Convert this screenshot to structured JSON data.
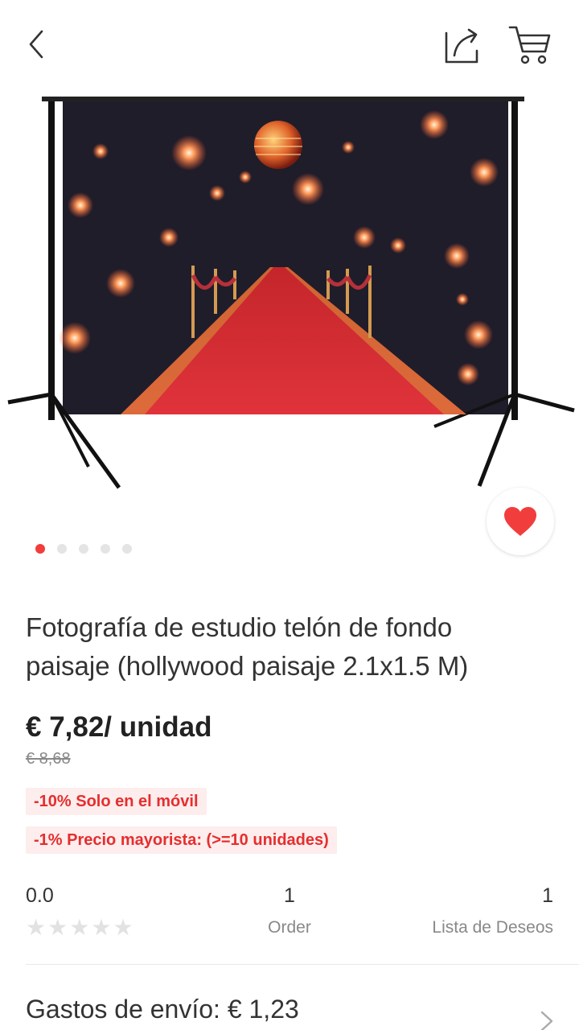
{
  "header": {
    "back_icon": "chevron-left-icon",
    "share_icon": "share-icon",
    "cart_icon": "cart-icon"
  },
  "gallery": {
    "image_alt": "Red carpet studio backdrop photo",
    "dot_count": 5,
    "active_index": 0,
    "favorite_icon": "heart-icon",
    "accent_color": "#f23d3d"
  },
  "product": {
    "title": "Fotografía de estudio telón de fondo paisaje (hollywood paisaje 2.1x1.5 M)",
    "price": "€ 7,82/ unidad",
    "old_price": "€ 8,68",
    "promos": [
      "-10% Solo en el móvil",
      "-1% Precio mayorista: (>=10 unidades)"
    ]
  },
  "stats": {
    "rating": "0.0",
    "stars_filled": 0,
    "orders_count": "1",
    "orders_label": "Order",
    "wishlist_count": "1",
    "wishlist_label": "Lista de Deseos"
  },
  "shipping": {
    "label": "Gastos de envío: € 1,23"
  }
}
